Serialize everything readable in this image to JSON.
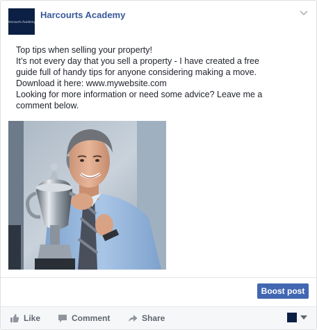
{
  "post": {
    "page_name": "Harcourts Academy",
    "avatar_text": "Harcourts Academy",
    "body_lines": [
      "Top tips when selling your property!",
      "It’s not every day that you sell a property - I have created a free",
      "guide full of handy tips for anyone considering making a move.",
      "Download it here: www.mywebsite.com",
      "Looking for more information or need some advice? Leave me a",
      "comment below."
    ],
    "options_icon": "chevron-down-icon"
  },
  "boost": {
    "label": "Boost post"
  },
  "actions": {
    "like": "Like",
    "comment": "Comment",
    "share": "Share"
  },
  "colors": {
    "page_name": "#365899",
    "boost_button": "#4267b2",
    "avatar": "#0c1f44",
    "action_text": "#606770"
  }
}
